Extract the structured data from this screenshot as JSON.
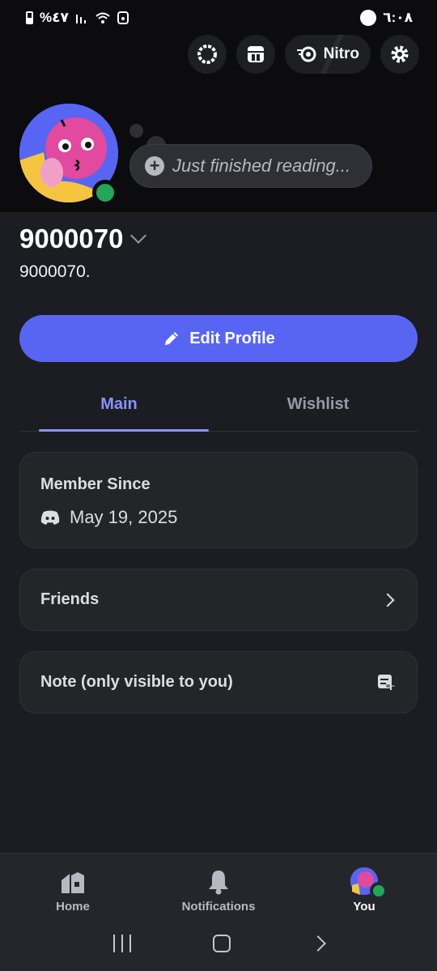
{
  "status_bar": {
    "battery_text": "%٤٧",
    "time": "٦:٠٨"
  },
  "top_actions": {
    "nitro_label": "Nitro"
  },
  "status_bubble": {
    "placeholder": "Just finished reading..."
  },
  "profile": {
    "display_name": "9000070",
    "username": "9000070.",
    "online_color": "#23a55a"
  },
  "edit_profile_label": "Edit Profile",
  "tabs": [
    {
      "label": "Main",
      "active": true
    },
    {
      "label": "Wishlist",
      "active": false
    }
  ],
  "member_since": {
    "title": "Member Since",
    "date": "May 19, 2025"
  },
  "friends_label": "Friends",
  "note_label": "Note (only visible to you)",
  "bottom_nav": {
    "items": [
      {
        "label": "Home",
        "icon": "home-icon"
      },
      {
        "label": "Notifications",
        "icon": "bell-icon"
      },
      {
        "label": "You",
        "icon": "avatar"
      }
    ]
  },
  "colors": {
    "accent": "#5865f2",
    "tab_active": "#8b93f8",
    "background": "#1c1d22"
  }
}
